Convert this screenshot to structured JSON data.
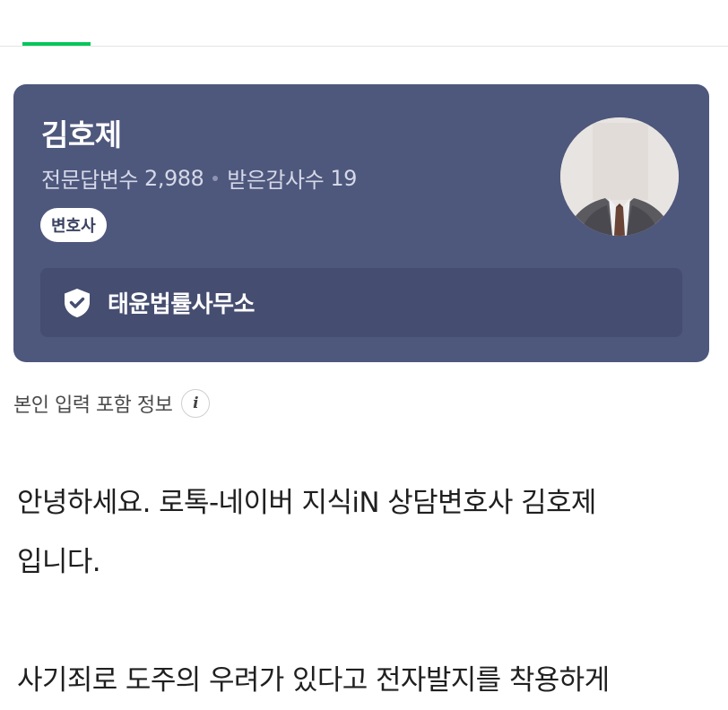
{
  "tabs": {
    "active_indicator_color": "#03c75a"
  },
  "expert": {
    "name": "김호제",
    "answers_label": "전문답변수",
    "answers_count": "2,988",
    "thanks_label": "받은감사수",
    "thanks_count": "19",
    "badge": "변호사",
    "firm": "태윤법률사무소",
    "card_color": "#4e577c",
    "firm_bar_color": "#454d70"
  },
  "info": {
    "label": "본인 입력 포함 정보",
    "icon": "info-icon",
    "icon_glyph": "i"
  },
  "answer": {
    "lines": [
      "안녕하세요. 로톡-네이버 지식iN 상담변호사 김호제",
      "입니다.",
      "",
      "사기죄로 도주의 우려가 있다고 전자발지를 착용하게"
    ]
  }
}
